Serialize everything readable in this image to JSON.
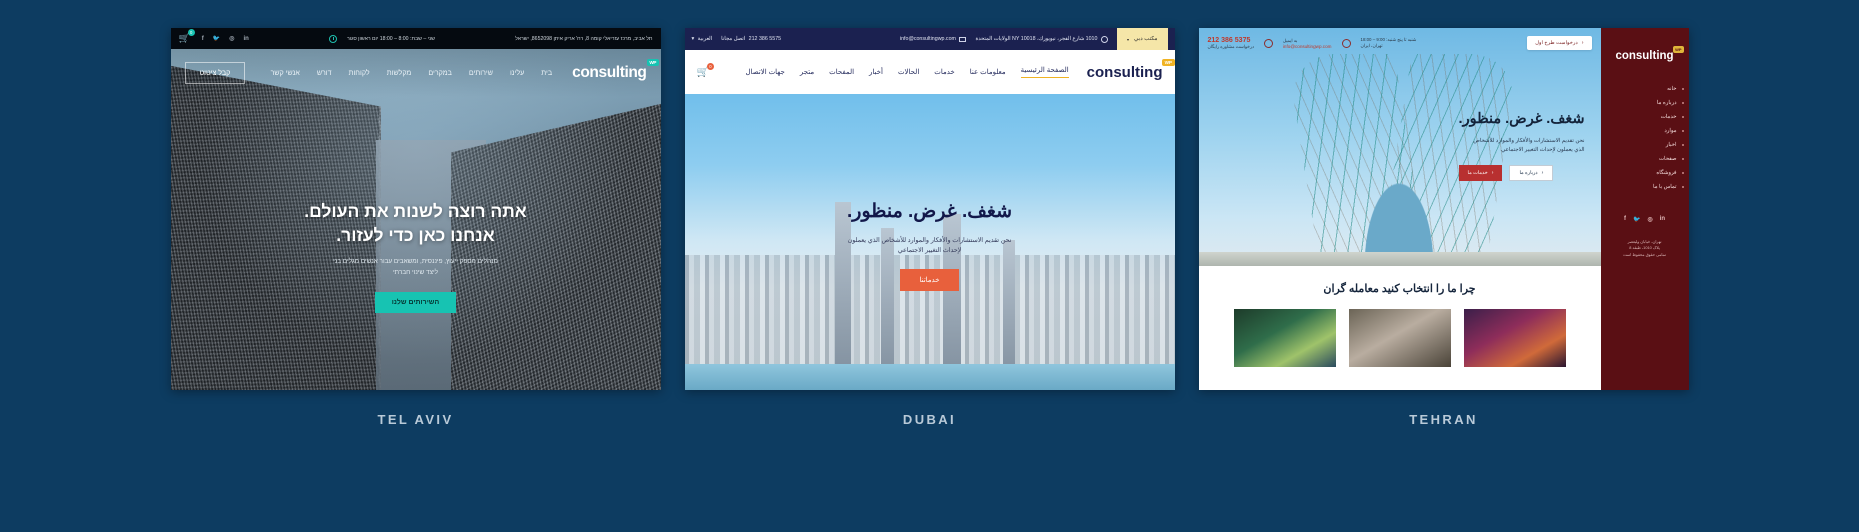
{
  "page": {
    "background_color": "#0d3c61",
    "layout": "three-demo-showcase"
  },
  "cards": [
    {
      "id": "tel-aviv",
      "city_label": "TEL AVIV",
      "direction": "rtl",
      "language": "Hebrew",
      "accent_color": "#17c3b2",
      "topbar": {
        "address": "תל אביב, מרכז עזריאלי קומה 8, רח' אריק איתן 8652098, ישראל",
        "hours": "שני – שבת: 8:00 – 18:00 יום ראשון סגור",
        "clock_icon": "clock-icon",
        "cart_icon": "cart-icon",
        "cart_count": "0",
        "socials": [
          "linkedin-icon",
          "instagram-icon",
          "twitter-icon",
          "facebook-icon"
        ]
      },
      "nav": {
        "logo": "consulting",
        "logo_badge": "WP",
        "links": [
          "בית",
          "עלינו",
          "שירותים",
          "במקרים",
          "מקלשות",
          "לקוחות",
          "דורש",
          "אנשי קשר"
        ],
        "button": "קבל ציטוט"
      },
      "hero": {
        "title_line1": "אתה רוצה לשנות את העולם.",
        "title_line2": "אנחנו כאן כדי לעזור.",
        "subtitle": "מנהלים מספק ייעוץ, פיננסית, ומשאבים עבור אנשים מגלים בני",
        "subtitle_line2": "ליצד שינוי חברתי",
        "cta": "השירותים שלנו"
      }
    },
    {
      "id": "dubai",
      "city_label": "DUBAI",
      "direction": "rtl",
      "language": "Arabic",
      "accent_color": "#e8603c",
      "topbar": {
        "lang_selector": "مكتب دبي",
        "lang_caret": "chevron-down-icon",
        "language_label": "العربية",
        "address": "1010 شارع الفجر، نيويورك، NY 10018 الولايات المتحدة",
        "phone": "5575 386 212",
        "phone_label": "اتصل مجانا",
        "email": "info@consultingwp.com",
        "pin_icon": "location-pin-icon",
        "envelope_icon": "envelope-icon"
      },
      "nav": {
        "logo": "consulting",
        "logo_badge": "WP",
        "links": [
          "الصفحة الرئيسية",
          "معلومات عنا",
          "خدمات",
          "الحالات",
          "أخبار",
          "المفحات",
          "متجر",
          "جهات الاتصال"
        ],
        "active_link": "الصفحة الرئيسية",
        "cart_icon": "cart-icon",
        "cart_count": "0"
      },
      "hero": {
        "title": "شغف. غرض. منظور.",
        "subtitle": "نحن تقديم الاستشارات والأفكار والموارد للأشخاص الذي يعملون",
        "subtitle_line2": "لإحداث التغيير الاجتماعي",
        "cta": "خدماتنا"
      }
    },
    {
      "id": "tehran",
      "city_label": "TEHRAN",
      "direction": "rtl",
      "language": "Persian",
      "accent_color": "#b83030",
      "topbar": {
        "quote_button": "درخواست طرح اول",
        "quote_caret": "chevron-left-icon",
        "hours_line1": "شنبه تا پنج شنبه: 9:00 – 18:00",
        "hours_line2": "تهران، ایران",
        "email": "info@consultingwp.com",
        "email_label": "به ایمیل",
        "phone": "5375 386 212",
        "phone_label": "درخواست مشاوره رایگان",
        "clock_icon": "clock-icon",
        "envelope_icon": "envelope-icon",
        "phone_icon": "phone-icon"
      },
      "hero": {
        "title": "شغف. غرض. منظور.",
        "subtitle": "نحن تقديم الاستشارات والأفكار والموارد للأشخاص",
        "subtitle_line2": "الذي يعملون لإحداث التغيير الاجتماعي",
        "btn_primary": "خدمات ما",
        "btn_primary_icon": "chevron-left-icon",
        "btn_secondary": "درباره ما",
        "btn_secondary_icon": "chevron-left-icon"
      },
      "lower": {
        "heading": "چرا ما را انتخاب کنید معامله گران",
        "thumbs": [
          "thumbnail-landscape-1",
          "thumbnail-portrait-2",
          "thumbnail-city-3"
        ]
      },
      "sidebar": {
        "logo": "consulting",
        "logo_badge": "WP",
        "links": [
          "خانه",
          "درباره ما",
          "خدمات",
          "موارد",
          "اخبار",
          "صفحات",
          "فروشگاه",
          "تماس با ما"
        ],
        "socials": [
          "linkedin-icon",
          "instagram-icon",
          "twitter-icon",
          "facebook-icon"
        ],
        "footer_line1": "تهران، خیابان ولیعصر",
        "footer_line2": "پلاک 1010، طبقه 8",
        "footer_line3": "تمامی حقوق محفوظ است"
      }
    }
  ]
}
